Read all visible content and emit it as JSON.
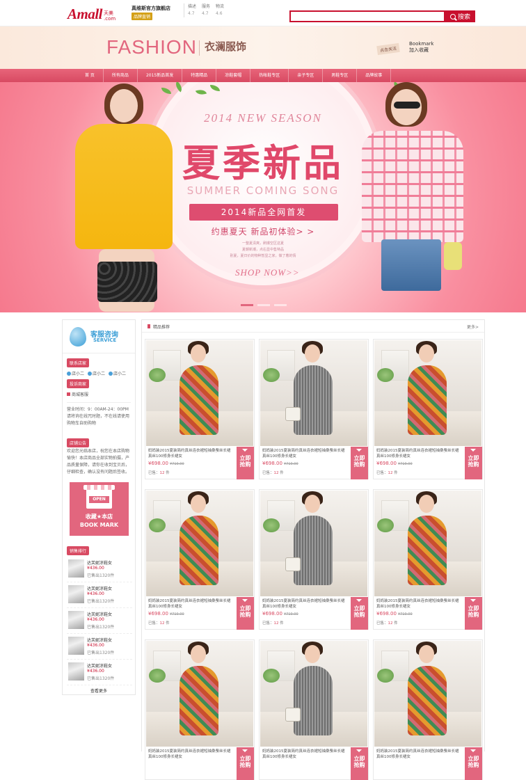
{
  "topbar": {
    "logo_main": "Amall",
    "logo_sub": "天美",
    "logo_dot": ".com",
    "shop_name": "真维斯官方旗舰店",
    "shop_badge": "品牌直销",
    "ratings": [
      {
        "label": "描述",
        "value": "4.7"
      },
      {
        "label": "服务",
        "value": "4.7"
      },
      {
        "label": "物流",
        "value": "4.6"
      }
    ],
    "search_button": "搜索",
    "search_value": ""
  },
  "header": {
    "brand_en": "FASHION",
    "brand_cn": "衣澜服饰",
    "follow_label": "点击关注",
    "bookmark_en": "Bookmark",
    "bookmark_cn": "加入收藏"
  },
  "nav": [
    {
      "label": "首 页"
    },
    {
      "label": "所有商品"
    },
    {
      "label": "2015新品首发"
    },
    {
      "label": "特惠精品"
    },
    {
      "label": "凉鞋套帽"
    },
    {
      "label": "热帐鞋专区"
    },
    {
      "label": "亲子专区"
    },
    {
      "label": "男鞋专区"
    },
    {
      "label": "品牌故事"
    }
  ],
  "banner": {
    "season": "2014 NEW SEASON",
    "headline": "夏季新品",
    "subtitle_en": "SUMMER COMING SONG",
    "pill": "2014新品全网首发",
    "tagline": "约惠夏天  新品初体验> >",
    "small_line1": "一整夏清爽，刷爆空区这夏",
    "small_line2": "夏朝新潮，点右显中售特品",
    "small_line3": "别夏，夏日价的物种暂显之家，做了着的情",
    "cta": "SHOP NOW>>"
  },
  "sidebar": {
    "service_cn": "客服咨询",
    "service_en": "SERVICE",
    "contact_tag": "联系店家",
    "agents": [
      "店小二",
      "店小二",
      "店小二"
    ],
    "complaint_tag": "投诉商家",
    "mall_service": "商城客服",
    "hours": "营业时间：9：00AM-24：00PM请将询在线咒时题，不在线请使用购物车自助购物",
    "notice_tag": "店铺公告",
    "notice": "欢迎您光临本店，祝您在本店购物愉快！本店商品全部实物拍摄，产品质量保障，请你在收到宝贝后，仔细检查，确认没有问题后签收。",
    "bm_open": "OPEN",
    "bm_cn": "收藏★本店",
    "bm_en": "BOOK MARK",
    "rank_tag": "销售排行",
    "rank_items": [
      {
        "name": "达芙妮凉鞋女",
        "price": "¥436.00",
        "sold": "已售出1320件"
      },
      {
        "name": "达芙妮凉鞋女",
        "price": "¥436.00",
        "sold": "已售出1320件"
      },
      {
        "name": "达芙妮凉鞋女",
        "price": "¥436.00",
        "sold": "已售出1320件"
      },
      {
        "name": "达芙妮凉鞋女",
        "price": "¥436.00",
        "sold": "已售出1320件"
      },
      {
        "name": "达芙妮凉鞋女",
        "price": "¥436.00",
        "sold": "已售出1320件"
      }
    ],
    "more": "查看更多"
  },
  "main": {
    "section_title": "精品推荐",
    "more": "更多>",
    "products": [
      {
        "title": "妈妈装2015夏装简约真丝连衣裙短袖桑蚕丝长裙真丝100修身长裙女",
        "price": "¥698.00",
        "old_price": "¥719.00",
        "sold_label": "已售：",
        "sold": "12",
        "unit": "件",
        "buy_line1": "立即",
        "buy_line2": "抢购",
        "style": "floral"
      },
      {
        "title": "妈妈装2015夏装简约真丝连衣裙短袖桑蚕丝长裙真丝100修身长裙女",
        "price": "¥698.00",
        "old_price": "¥719.00",
        "sold_label": "已售：",
        "sold": "12",
        "unit": "件",
        "buy_line1": "立即",
        "buy_line2": "抢购",
        "style": "grey"
      },
      {
        "title": "妈妈装2015夏装简约真丝连衣裙短袖桑蚕丝长裙真丝100修身长裙女",
        "price": "¥698.00",
        "old_price": "¥719.00",
        "sold_label": "已售：",
        "sold": "12",
        "unit": "件",
        "buy_line1": "立即",
        "buy_line2": "抢购",
        "style": "floral"
      },
      {
        "title": "妈妈装2015夏装简约真丝连衣裙短袖桑蚕丝长裙真丝100修身长裙女",
        "price": "¥698.00",
        "old_price": "¥719.00",
        "sold_label": "已售：",
        "sold": "12",
        "unit": "件",
        "buy_line1": "立即",
        "buy_line2": "抢购",
        "style": "floral"
      },
      {
        "title": "妈妈装2015夏装简约真丝连衣裙短袖桑蚕丝长裙真丝100修身长裙女",
        "price": "¥698.00",
        "old_price": "¥719.00",
        "sold_label": "已售：",
        "sold": "12",
        "unit": "件",
        "buy_line1": "立即",
        "buy_line2": "抢购",
        "style": "grey"
      },
      {
        "title": "妈妈装2015夏装简约真丝连衣裙短袖桑蚕丝长裙真丝100修身长裙女",
        "price": "¥698.00",
        "old_price": "¥719.00",
        "sold_label": "已售：",
        "sold": "12",
        "unit": "件",
        "buy_line1": "立即",
        "buy_line2": "抢购",
        "style": "floral"
      },
      {
        "title": "妈妈装2015夏装简约真丝连衣裙短袖桑蚕丝长裙真丝100修身长裙女",
        "price": "",
        "old_price": "",
        "sold_label": "",
        "sold": "",
        "unit": "",
        "buy_line1": "立即",
        "buy_line2": "抢购",
        "style": "floral"
      },
      {
        "title": "妈妈装2015夏装简约真丝连衣裙短袖桑蚕丝长裙真丝100修身长裙女",
        "price": "",
        "old_price": "",
        "sold_label": "",
        "sold": "",
        "unit": "",
        "buy_line1": "立即",
        "buy_line2": "抢购",
        "style": "grey"
      },
      {
        "title": "妈妈装2015夏装简约真丝连衣裙短袖桑蚕丝长裙真丝100修身长裙女",
        "price": "",
        "old_price": "",
        "sold_label": "",
        "sold": "",
        "unit": "",
        "buy_line1": "立即",
        "buy_line2": "抢购",
        "style": "floral"
      }
    ]
  },
  "colors": {
    "brand_red": "#c8102e",
    "accent_pink": "#e2667e",
    "nav_pink": "#d84a62"
  },
  "icons": [
    "search-icon",
    "service-droplet-icon",
    "agent-chat-icon",
    "shop-open-icon",
    "bookmark-plus-icon"
  ]
}
